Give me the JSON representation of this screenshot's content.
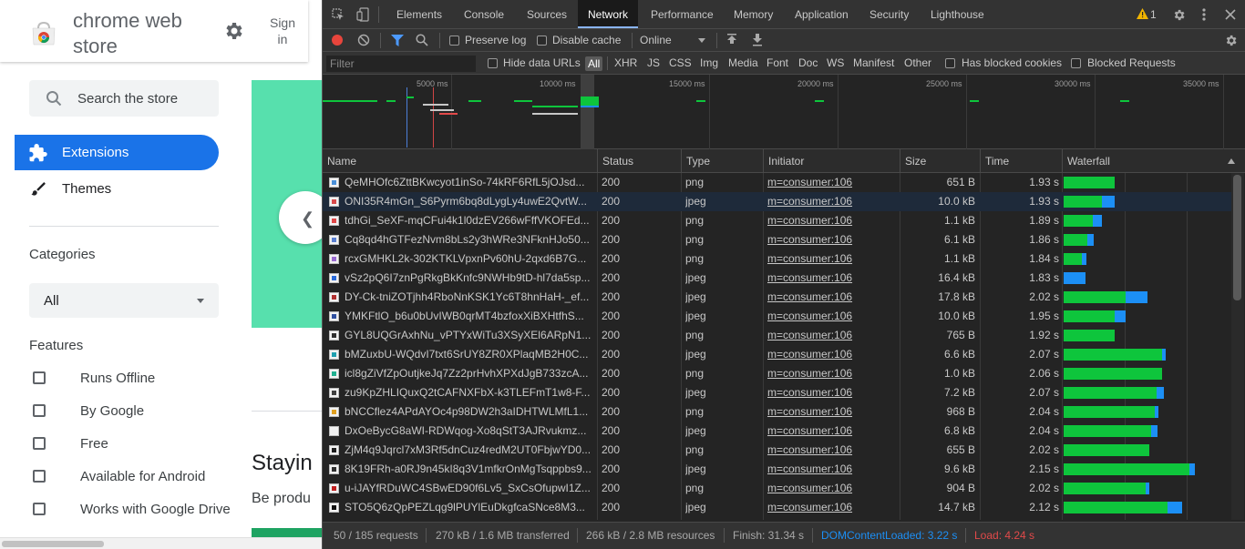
{
  "store": {
    "title": "chrome web store",
    "signin": "Sign in",
    "search_placeholder": "Search the store",
    "nav": {
      "extensions": "Extensions",
      "themes": "Themes"
    },
    "categories_title": "Categories",
    "category_selected": "All",
    "features_title": "Features",
    "features": [
      "Runs Offline",
      "By Google",
      "Free",
      "Available for Android",
      "Works with Google Drive"
    ],
    "headline": "Stayin",
    "subline": "Be produ",
    "accent": "#1a73e8",
    "banner_color": "#57e0ad"
  },
  "devtools": {
    "tabs": [
      "Elements",
      "Console",
      "Sources",
      "Network",
      "Performance",
      "Memory",
      "Application",
      "Security",
      "Lighthouse"
    ],
    "active_tab": "Network",
    "warning_count": "1",
    "toolbar": {
      "preserve_log": "Preserve log",
      "disable_cache": "Disable cache",
      "throttling": "Online"
    },
    "filter": {
      "placeholder": "Filter",
      "hide_data_urls": "Hide data URLs",
      "all": "All",
      "types": [
        "XHR",
        "JS",
        "CSS",
        "Img",
        "Media",
        "Font",
        "Doc",
        "WS",
        "Manifest",
        "Other"
      ],
      "has_blocked_cookies": "Has blocked cookies",
      "blocked_requests": "Blocked Requests"
    },
    "overview_ticks": [
      "5000 ms",
      "10000 ms",
      "15000 ms",
      "20000 ms",
      "25000 ms",
      "30000 ms",
      "35000 ms"
    ],
    "columns": [
      "Name",
      "Status",
      "Type",
      "Initiator",
      "Size",
      "Time",
      "Waterfall"
    ],
    "rows": [
      {
        "name": "QeMHOfc6ZttBKwcyot1inSo-74kRF6RfL5jOJsd...",
        "status": "200",
        "type": "png",
        "initiator": "m=consumer:106",
        "size": "651 B",
        "time": "1.93 s",
        "icon": "#4a90d9",
        "wf_green": 56,
        "wf_blue": 0
      },
      {
        "name": "ONI35R4mGn_S6Pyrm6bq8dLygLy4uwE2QvtW...",
        "status": "200",
        "type": "jpeg",
        "initiator": "m=consumer:106",
        "size": "10.0 kB",
        "time": "1.93 s",
        "icon": "#d94a4a",
        "wf_green": 42,
        "wf_blue": 14
      },
      {
        "name": "tdhGi_SeXF-mqCFui4k1l0dzEV266wFffVKOFEd...",
        "status": "200",
        "type": "png",
        "initiator": "m=consumer:106",
        "size": "1.1 kB",
        "time": "1.89 s",
        "icon": "#e04848",
        "wf_green": 32,
        "wf_blue": 10
      },
      {
        "name": "Cq8qd4hGTFezNvm8bLs2y3hWRe3NFknHJo50...",
        "status": "200",
        "type": "png",
        "initiator": "m=consumer:106",
        "size": "6.1 kB",
        "time": "1.86 s",
        "icon": "#5a7fd0",
        "wf_green": 26,
        "wf_blue": 7
      },
      {
        "name": "rcxGMHKL2k-302KTKLVpxnPv60hU-2qxd6B7G...",
        "status": "200",
        "type": "png",
        "initiator": "m=consumer:106",
        "size": "1.1 kB",
        "time": "1.84 s",
        "icon": "#9a6ad0",
        "wf_green": 20,
        "wf_blue": 5
      },
      {
        "name": "vSz2pQ6I7znPgRkgBkKnfc9NWHb9tD-hl7da5sp...",
        "status": "200",
        "type": "jpeg",
        "initiator": "m=consumer:106",
        "size": "16.4 kB",
        "time": "1.83 s",
        "icon": "#2a6ad9",
        "wf_green": 0,
        "wf_blue": 24
      },
      {
        "name": "DY-Ck-tniZOTjhh4RboNnKSK1Yc6T8hnHaH-_ef...",
        "status": "200",
        "type": "jpeg",
        "initiator": "m=consumer:106",
        "size": "17.8 kB",
        "time": "2.02 s",
        "icon": "#b03030",
        "wf_green": 68,
        "wf_blue": 24
      },
      {
        "name": "YMKFtlO_b6u0bUvIWB0qrMT4bzfoxXiBXHtfhS...",
        "status": "200",
        "type": "jpeg",
        "initiator": "m=consumer:106",
        "size": "10.0 kB",
        "time": "1.95 s",
        "icon": "#3050a0",
        "wf_green": 56,
        "wf_blue": 12
      },
      {
        "name": "GYL8UQGrAxhNu_vPTYxWiTu3XSyXEl6ARpN1...",
        "status": "200",
        "type": "png",
        "initiator": "m=consumer:106",
        "size": "765 B",
        "time": "1.92 s",
        "icon": "#303030",
        "wf_green": 56,
        "wf_blue": 0
      },
      {
        "name": "bMZuxbU-WQdvI7txt6SrUY8ZR0XPlaqMB2H0C...",
        "status": "200",
        "type": "jpeg",
        "initiator": "m=consumer:106",
        "size": "6.6 kB",
        "time": "2.07 s",
        "icon": "#20a0b0",
        "wf_green": 108,
        "wf_blue": 4
      },
      {
        "name": "icl8gZiVfZpOutjkeJq7Zz2prHvhXPXdJgB733zcA...",
        "status": "200",
        "type": "png",
        "initiator": "m=consumer:106",
        "size": "1.0 kB",
        "time": "2.06 s",
        "icon": "#20b090",
        "wf_green": 108,
        "wf_blue": 0
      },
      {
        "name": "zu9KpZHLIQuxQ2tCAFNXFbX-k3TLEFmT1w8-F...",
        "status": "200",
        "type": "jpeg",
        "initiator": "m=consumer:106",
        "size": "7.2 kB",
        "time": "2.07 s",
        "icon": "#404040",
        "wf_green": 102,
        "wf_blue": 8
      },
      {
        "name": "bNCCflez4APdAYOc4p98DW2h3aIDHTWLMfL1...",
        "status": "200",
        "type": "png",
        "initiator": "m=consumer:106",
        "size": "968 B",
        "time": "2.04 s",
        "icon": "#e0a020",
        "wf_green": 100,
        "wf_blue": 4
      },
      {
        "name": "DxOeBycG8aWI-RDWqog-Xo8qStT3AJRvukmz...",
        "status": "200",
        "type": "jpeg",
        "initiator": "m=consumer:106",
        "size": "6.8 kB",
        "time": "2.04 s",
        "icon": "#f0f0f0",
        "wf_green": 96,
        "wf_blue": 7
      },
      {
        "name": "ZjM4q9Jqrcl7xM3Rf5dnCuz4redM2UT0FbjwYD0...",
        "status": "200",
        "type": "png",
        "initiator": "m=consumer:106",
        "size": "655 B",
        "time": "2.02 s",
        "icon": "#202020",
        "wf_green": 94,
        "wf_blue": 0
      },
      {
        "name": "8K19FRh-a0RJ9n45kI8q3V1mfkrOnMgTsqppbs9...",
        "status": "200",
        "type": "jpeg",
        "initiator": "m=consumer:106",
        "size": "9.6 kB",
        "time": "2.15 s",
        "icon": "#303030",
        "wf_green": 138,
        "wf_blue": 6
      },
      {
        "name": "u-iJAYfRDuWC4SBwED90f6Lv5_SxCsOfupwI1Z...",
        "status": "200",
        "type": "png",
        "initiator": "m=consumer:106",
        "size": "904 B",
        "time": "2.02 s",
        "icon": "#c02020",
        "wf_green": 90,
        "wf_blue": 4
      },
      {
        "name": "STO5Q6zQpPEZLqg9lPUYlEuDkgfcaSNce8M3...",
        "status": "200",
        "type": "jpeg",
        "initiator": "m=consumer:106",
        "size": "14.7 kB",
        "time": "2.12 s",
        "icon": "#101010",
        "wf_green": 114,
        "wf_blue": 16
      }
    ],
    "status": {
      "requests": "50 / 185 requests",
      "transferred": "270 kB / 1.6 MB transferred",
      "resources": "266 kB / 2.8 MB resources",
      "finish": "Finish: 31.34 s",
      "dom_content_loaded": "DOMContentLoaded: 3.22 s",
      "load": "Load: 4.24 s"
    },
    "colors": {
      "waterfall_green": "#0ec53c",
      "waterfall_blue": "#1c8ff5",
      "dcl": "#1c8ff5",
      "load": "#e24a4a"
    }
  }
}
